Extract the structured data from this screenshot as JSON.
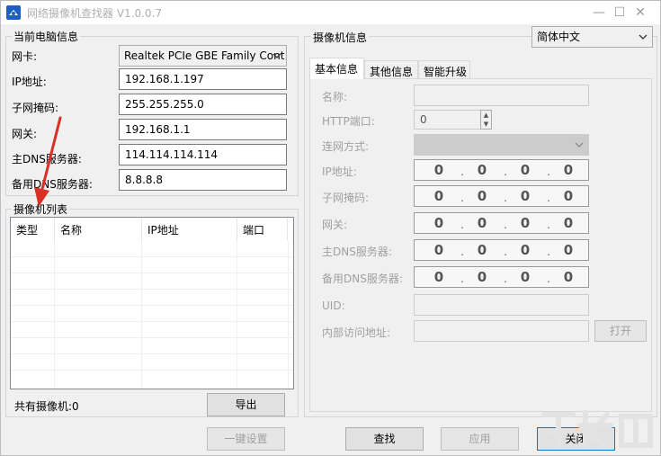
{
  "window": {
    "title": "网络摄像机查找器 V1.0.0.7",
    "controls": {
      "minimize": "—",
      "maximize": "☐",
      "close": "✕"
    }
  },
  "pc_info": {
    "group_title": "当前电脑信息",
    "nic_label": "网卡:",
    "nic_value": "Realtek PCIe GBE Family Cont",
    "ip_label": "IP地址:",
    "ip_value": "192.168.1.197",
    "mask_label": "子网掩码:",
    "mask_value": "255.255.255.0",
    "gateway_label": "网关:",
    "gateway_value": "192.168.1.1",
    "dns1_label": "主DNS服务器:",
    "dns1_value": "114.114.114.114",
    "dns2_label": "备用DNS服务器:",
    "dns2_value": "8.8.8.8"
  },
  "camera_list": {
    "group_title": "摄像机列表",
    "columns": [
      "类型",
      "名称",
      "IP地址",
      "端口"
    ],
    "count_label": "共有摄像机:0",
    "export_button": "导出"
  },
  "camera_info": {
    "title": "摄像机信息",
    "language": "简体中文",
    "tabs": [
      "基本信息",
      "其他信息",
      "智能升级"
    ],
    "name_label": "名称:",
    "name_value": "",
    "http_port_label": "HTTP端口:",
    "http_port_value": "0",
    "net_mode_label": "连网方式:",
    "ip_label": "IP地址:",
    "mask_label": "子网掩码:",
    "gateway_label": "网关:",
    "dns1_label": "主DNS服务器:",
    "dns2_label": "备用DNS服务器:",
    "ip_octets": [
      "0",
      "0",
      "0",
      "0"
    ],
    "uid_label": "UID:",
    "uid_value": "",
    "internal_label": "内部访问地址:",
    "internal_value": "",
    "open_button": "打开"
  },
  "footer": {
    "one_key_button": "一键设置",
    "find_button": "查找",
    "apply_button": "应用",
    "close_button": "关闭"
  },
  "colors": {
    "arrow": "#d93025",
    "focus_border": "#0078d7",
    "app_icon": "#1f5fbf"
  }
}
